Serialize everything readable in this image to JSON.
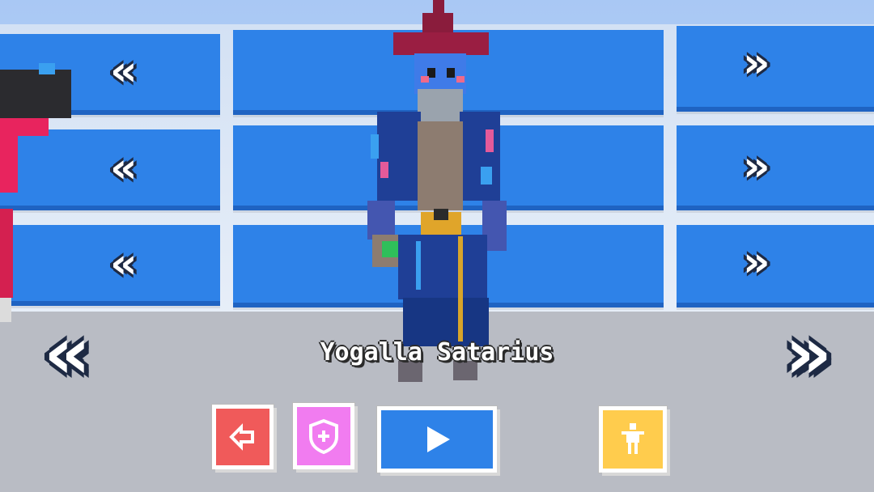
{
  "character": {
    "name": "Yogalla Satarius"
  },
  "controls": {
    "prev_icon": "chevron-left",
    "next_icon": "chevron-right",
    "exit_icon": "exit-arrow-icon",
    "shield_icon": "shield-icon",
    "play_icon": "play-icon",
    "avatar_icon": "person-icon"
  },
  "wall_arrows": {
    "left": "«",
    "right": "»"
  },
  "colors": {
    "wall_panel": "#2e82e8",
    "exit_button": "#f05a5a",
    "shield_button": "#f17cf0",
    "play_button": "#2e82e8",
    "avatar_button": "#ffcc4d"
  }
}
